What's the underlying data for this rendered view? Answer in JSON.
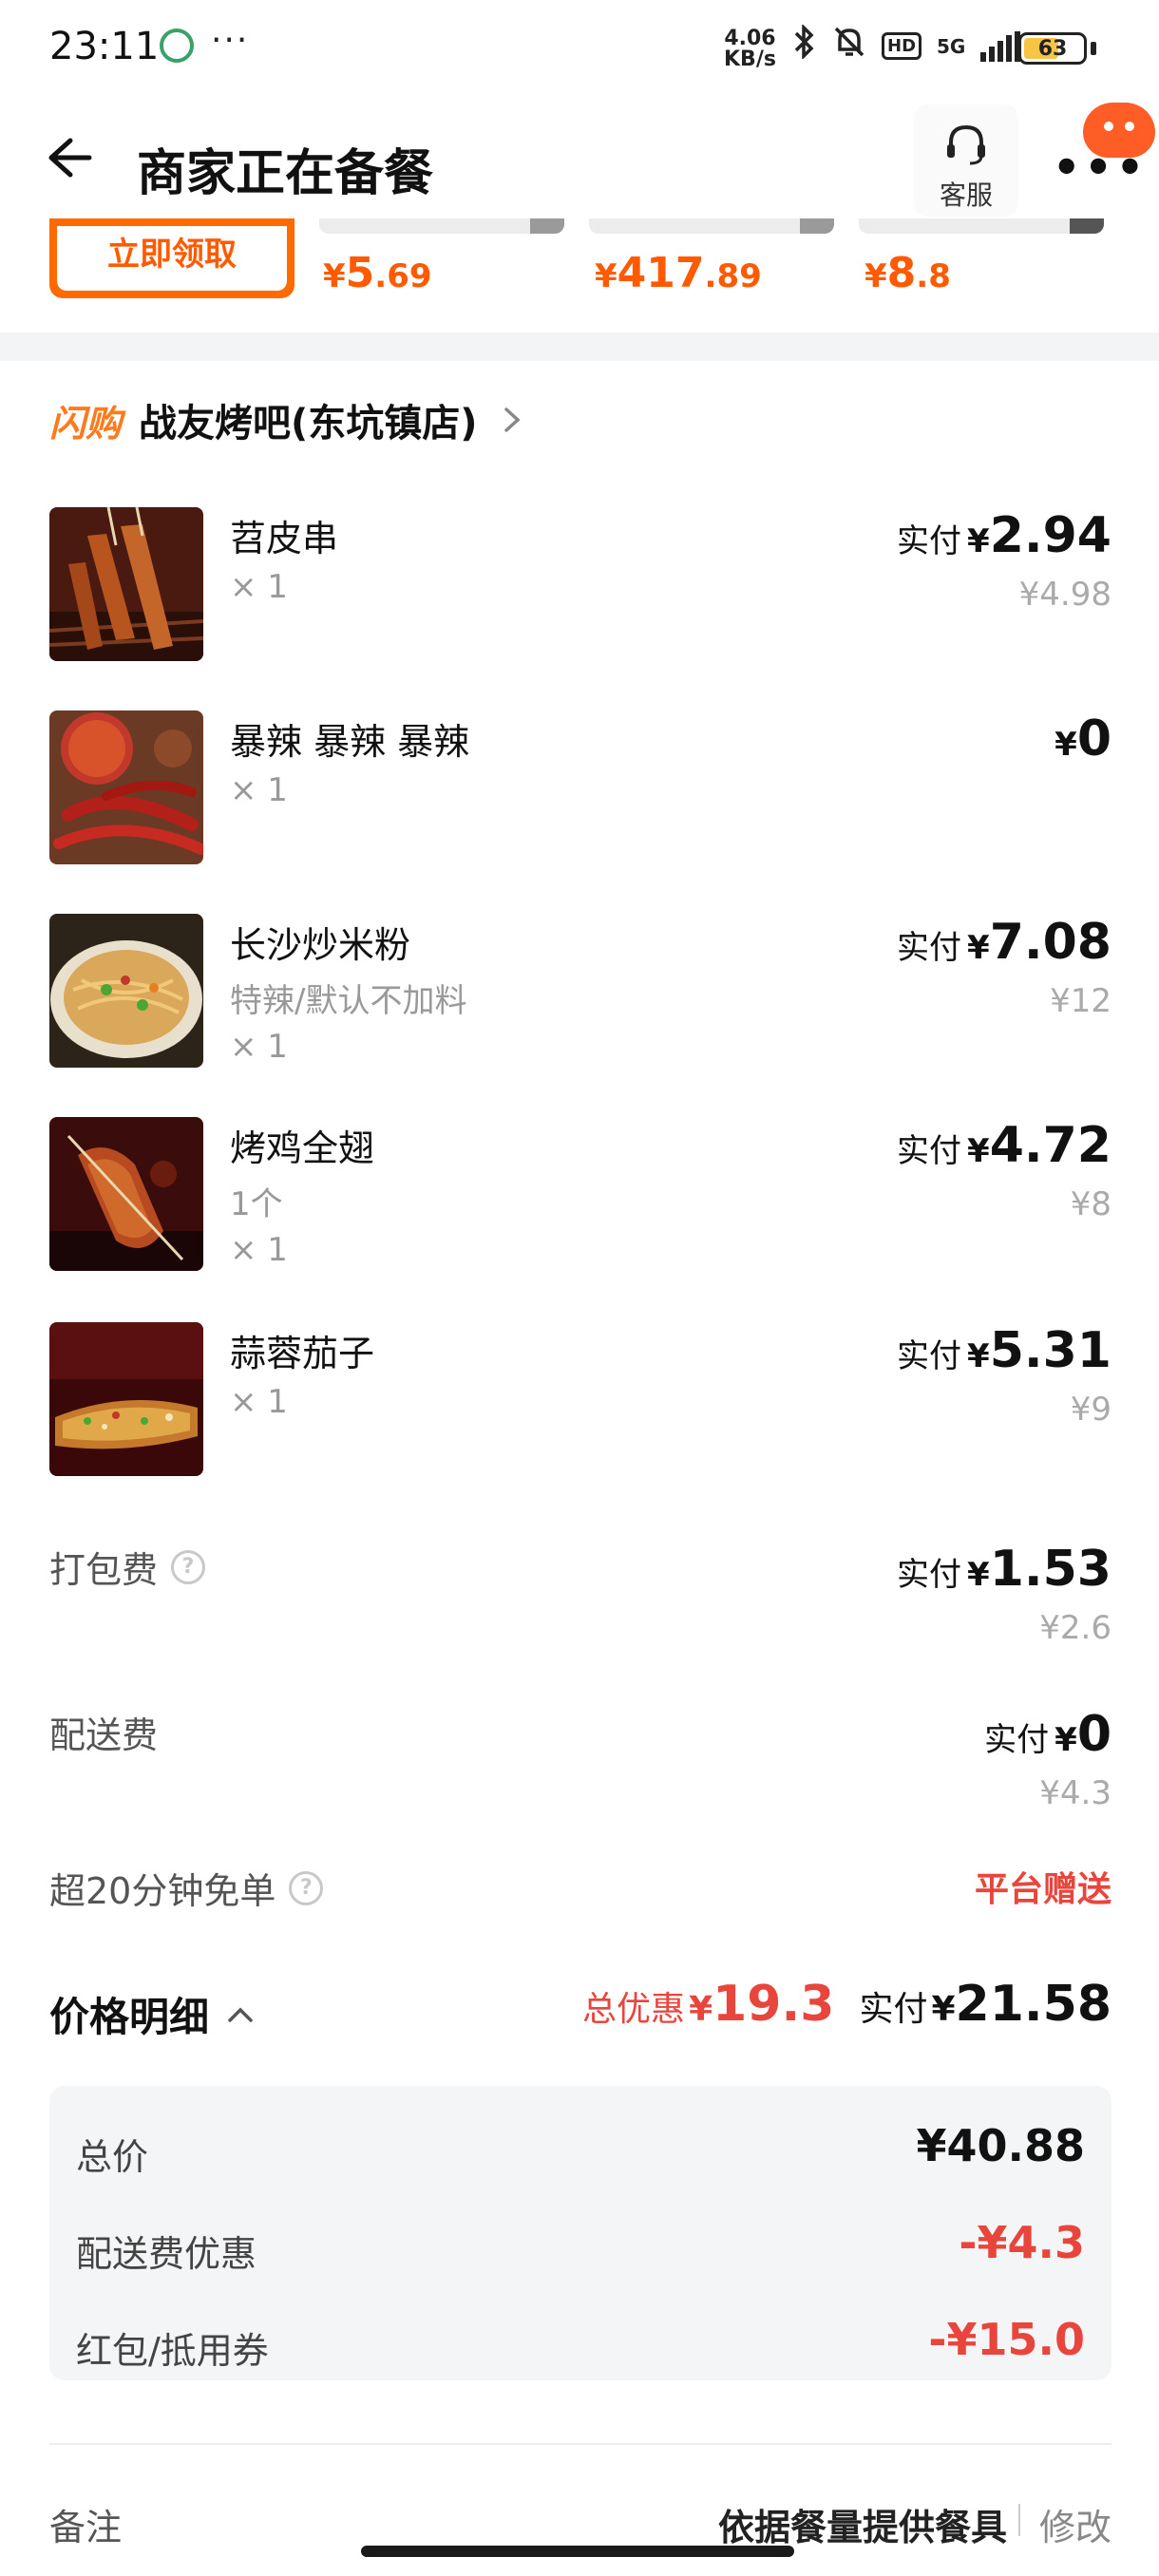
{
  "status_bar": {
    "time": "23:11",
    "more": "···",
    "speed_value": "4.06",
    "speed_unit": "KB/s",
    "hd": "HD",
    "network": "5G",
    "battery": "63",
    "battery_level": 0.63
  },
  "header": {
    "title": "商家正在备餐",
    "service_label": "客服"
  },
  "coupons": {
    "claim_label": "立即领取",
    "items": [
      {
        "symbol": "¥",
        "int": "5",
        "dec": ".69"
      },
      {
        "symbol": "¥",
        "int": "417",
        "dec": ".89"
      },
      {
        "symbol": "¥",
        "int": "8",
        "dec": ".8"
      }
    ]
  },
  "store": {
    "tag": "闪购",
    "name": "战友烤吧(东坑镇店)"
  },
  "items": [
    {
      "name": "苕皮串",
      "spec": "",
      "qty": "× 1",
      "paid_label": "实付",
      "symbol": "¥",
      "paid": "2.94",
      "original": "¥4.98"
    },
    {
      "name": "暴辣 暴辣 暴辣",
      "spec": "",
      "qty": "× 1",
      "paid_label": "",
      "symbol": "¥",
      "paid": "0",
      "original": ""
    },
    {
      "name": "长沙炒米粉",
      "spec": "特辣/默认不加料",
      "qty": "× 1",
      "paid_label": "实付",
      "symbol": "¥",
      "paid": "7.08",
      "original": "¥12"
    },
    {
      "name": "烤鸡全翅",
      "spec": "1个",
      "qty": "× 1",
      "paid_label": "实付",
      "symbol": "¥",
      "paid": "4.72",
      "original": "¥8"
    },
    {
      "name": "蒜蓉茄子",
      "spec": "",
      "qty": "× 1",
      "paid_label": "实付",
      "symbol": "¥",
      "paid": "5.31",
      "original": "¥9"
    }
  ],
  "fees": {
    "packing": {
      "label": "打包费",
      "paid_label": "实付",
      "symbol": "¥",
      "paid": "1.53",
      "original": "¥2.6"
    },
    "delivery": {
      "label": "配送费",
      "paid_label": "实付",
      "symbol": "¥",
      "paid": "0",
      "original": "¥4.3"
    },
    "free_order": {
      "label": "超20分钟免单",
      "value": "平台赠送"
    }
  },
  "price_detail": {
    "title": "价格明细",
    "discount_label": "总优惠",
    "discount_symbol": "¥",
    "discount": "19.3",
    "total_label": "实付",
    "total_symbol": "¥",
    "total": "21.58",
    "lines": [
      {
        "label": "总价",
        "value": "¥40.88"
      },
      {
        "label": "配送费优惠",
        "value": "-¥4.3"
      },
      {
        "label": "红包/抵用券",
        "value": "-¥15.0"
      }
    ]
  },
  "remark": {
    "label": "备注",
    "value": "依据餐量提供餐具",
    "edit": "修改"
  },
  "colors": {
    "accent_orange": "#ff6a00",
    "discount_red": "#e8453c"
  }
}
